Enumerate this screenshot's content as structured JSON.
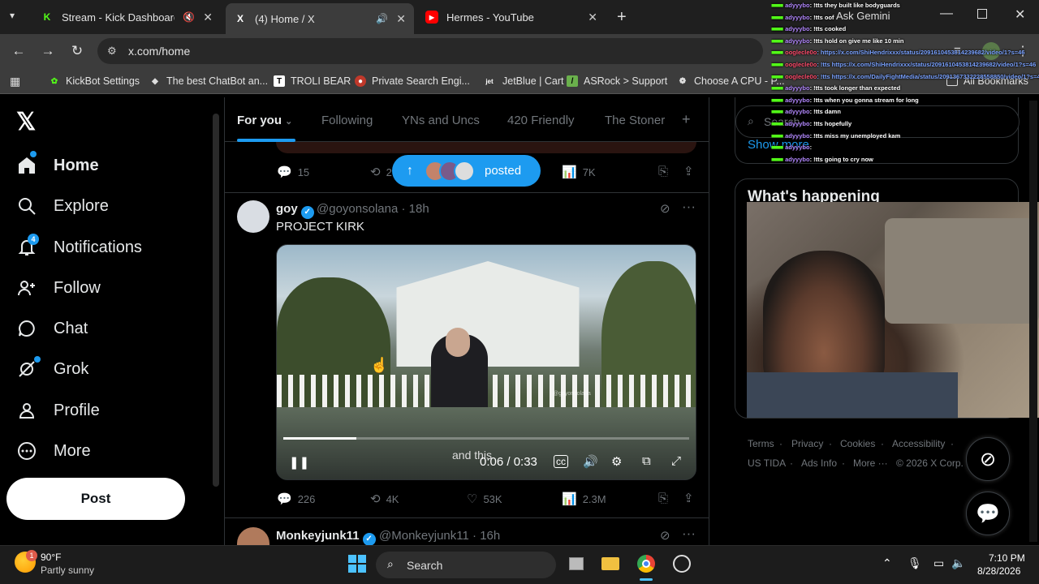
{
  "browser": {
    "tabs": [
      {
        "title": "Stream - Kick Dashboard",
        "favicon": "K",
        "muted": true
      },
      {
        "title": "(4) Home / X",
        "favicon": "X",
        "muted": false,
        "active": true
      },
      {
        "title": "Hermes - YouTube",
        "favicon": "▶"
      }
    ],
    "url": "x.com/home",
    "bookmarks": [
      "KickBot Settings",
      "The best ChatBot an...",
      "TROLI BEAR",
      "Private Search Engi...",
      "JetBlue | Cart",
      "ASRock > Support",
      "Choose A CPU - P..."
    ],
    "all_bookmarks": "All Bookmarks",
    "ask_gemini": "Ask Gemini"
  },
  "x_nav": {
    "items": [
      {
        "label": "Home",
        "icon": "home-icon"
      },
      {
        "label": "Explore",
        "icon": "search-icon"
      },
      {
        "label": "Notifications",
        "icon": "bell-icon",
        "badge": "4"
      },
      {
        "label": "Follow",
        "icon": "follow-icon"
      },
      {
        "label": "Chat",
        "icon": "chat-icon"
      },
      {
        "label": "Grok",
        "icon": "grok-icon"
      },
      {
        "label": "Profile",
        "icon": "profile-icon"
      },
      {
        "label": "More",
        "icon": "more-icon"
      }
    ],
    "post_label": "Post"
  },
  "feed": {
    "tabs": [
      "For you",
      "Following",
      "YNs and Uncs",
      "420 Friendly",
      "The Stoner"
    ],
    "prev_actions": {
      "replies": "15",
      "reposts": "2",
      "views": "7K"
    },
    "posted_pill": "posted",
    "tweet": {
      "name": "goy",
      "handle": "@goyonsolana",
      "time": "18h",
      "text": "PROJECT KIRK",
      "video_time": "0:06 / 0:33",
      "video_progress": 0.18,
      "caption": "and this",
      "watermark": "@goyonsolana",
      "replies": "226",
      "reposts": "4K",
      "likes": "53K",
      "views": "2.3M"
    },
    "next_tweet": {
      "name": "Monkeyjunk11",
      "handle": "@Monkeyjunk11",
      "time": "16h"
    }
  },
  "right": {
    "search_placeholder": "Search",
    "show_more": "Show more",
    "whats_happening": "What's happening",
    "footer": [
      "Terms",
      "Privacy",
      "Cookies",
      "Accessibility",
      "US TIDA",
      "Ads Info",
      "More ···",
      "© 2026 X Corp."
    ]
  },
  "chat": [
    {
      "user": "adyyybo",
      "msg": ": !tts they built like bodyguards"
    },
    {
      "user": "adyyybo",
      "msg": ": !tts oof"
    },
    {
      "user": "adyyybo",
      "msg": ": !tts cooked"
    },
    {
      "user": "adyyybo",
      "msg": ": !tts hold on give me like 10 min"
    },
    {
      "user": "ooglecle0o",
      "msg": ": https://x.com/ShiHendrixxx/status/2091610453814239682/video/1?s=46",
      "link": true
    },
    {
      "user": "ooglecle0o",
      "msg": ": !tts https://x.com/ShiHendrixxx/status/2091610453814239682/video/1?s=46",
      "link": true
    },
    {
      "user": "ooglecle0o",
      "msg": ": !tts https://x.com/DailyFightMedia/status/2091367332228558850/video/1?s=46",
      "link": true
    },
    {
      "user": "adyyybo",
      "msg": ": !tts took longer than expected"
    },
    {
      "user": "adyyybo",
      "msg": ": !tts when you gonna stream for long"
    },
    {
      "user": "adyyybo",
      "msg": ": !tts damn"
    },
    {
      "user": "adyyybo",
      "msg": ": !tts hopefully"
    },
    {
      "user": "adyyybo",
      "msg": ": !tts miss my unemployed kam"
    },
    {
      "user": "adyyybo",
      "msg": ": "
    },
    {
      "user": "adyyybo",
      "msg": ": !tts going to cry now"
    }
  ],
  "taskbar": {
    "weather_temp": "90°F",
    "weather_desc": "Partly sunny",
    "weather_badge": "1",
    "search": "Search",
    "time": "7:10 PM",
    "date": "8/28/2026"
  },
  "colors": {
    "accent": "#1d9bf0",
    "kick_green": "#53fc18"
  }
}
